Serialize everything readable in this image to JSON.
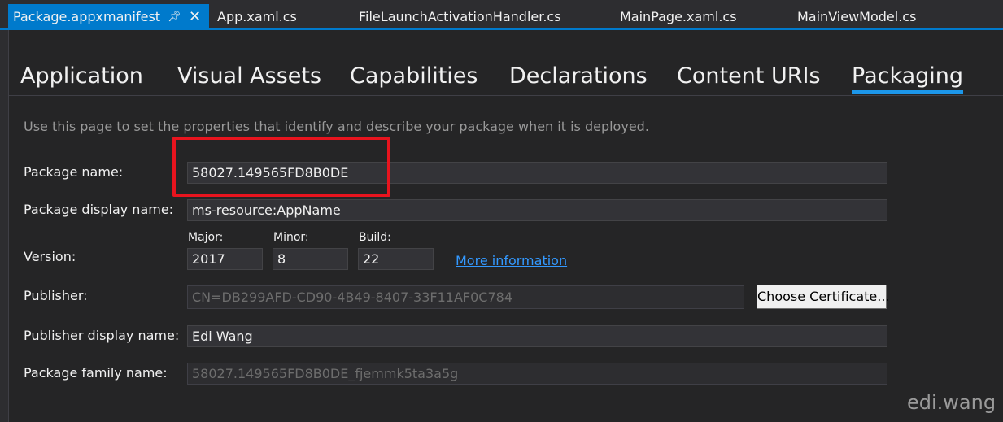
{
  "document_tabs": [
    {
      "label": "Package.appxmanifest",
      "active": true
    },
    {
      "label": "App.xaml.cs"
    },
    {
      "label": "FileLaunchActivationHandler.cs"
    },
    {
      "label": "MainPage.xaml.cs"
    },
    {
      "label": "MainViewModel.cs"
    }
  ],
  "section_tabs": [
    "Application",
    "Visual Assets",
    "Capabilities",
    "Declarations",
    "Content URIs",
    "Packaging"
  ],
  "selected_section": "Packaging",
  "intro_text": "Use this page to set the properties that identify and describe your package when it is deployed.",
  "form": {
    "package_name_label": "Package name:",
    "package_name_value": "58027.149565FD8B0DE",
    "display_name_label": "Package display name:",
    "display_name_value": "ms-resource:AppName",
    "version_label": "Version:",
    "major_label": "Major:",
    "major_value": "2017",
    "minor_label": "Minor:",
    "minor_value": "8",
    "build_label": "Build:",
    "build_value": "22",
    "more_info_link": "More information",
    "publisher_label": "Publisher:",
    "publisher_value": "CN=DB299AFD-CD90-4B49-8407-33F11AF0C784",
    "choose_certificate_label": "Choose Certificate...",
    "publisher_display_label": "Publisher display name:",
    "publisher_display_value": "Edi Wang",
    "family_name_label": "Package family name:",
    "family_name_value": "58027.149565FD8B0DE_fjemmk5ta3a5g"
  },
  "watermark": "edi.wang",
  "colors": {
    "accent": "#007acc",
    "highlight": "#e8141e",
    "link": "#3399ff"
  },
  "icons": {
    "pin": "pin-icon",
    "close": "close-icon"
  }
}
